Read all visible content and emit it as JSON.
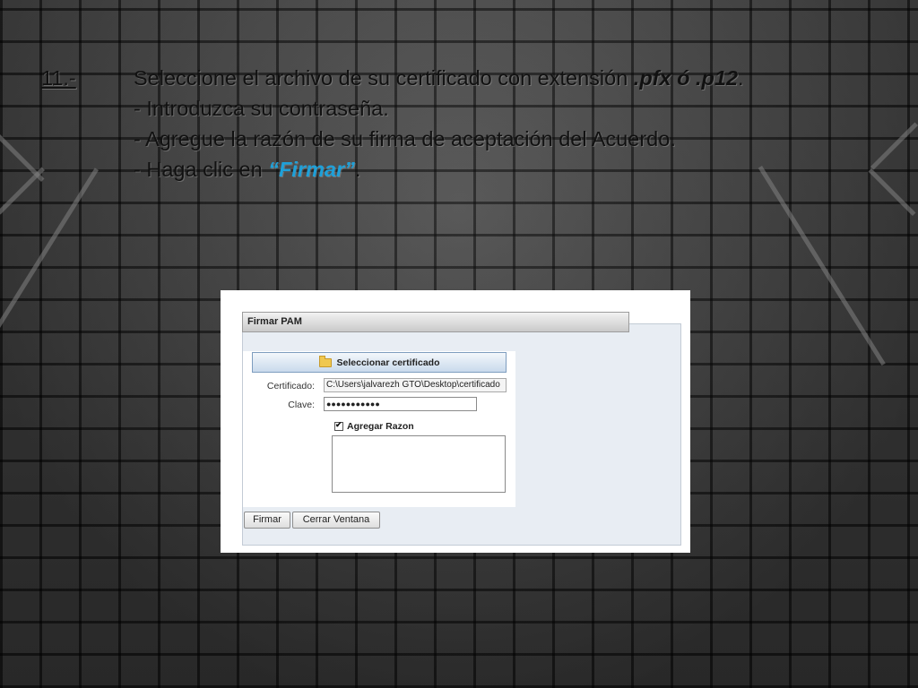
{
  "slide": {
    "step_number": "11.-",
    "line1_text": "Seleccione el archivo de su certificado con extensión ",
    "line1_emphasis": ".pfx ó .p12",
    "line1_end": ".",
    "line2": "- Introduzca su contraseña.",
    "line3": "- Agregue la razón de su firma de aceptación del Acuerdo.",
    "line4_prefix": "- Haga clic en ",
    "line4_emphasis": "“Firmar”",
    "line4_end": ".",
    "accent_color": "#1fa0d8"
  },
  "dialog": {
    "title": "Firmar PAM",
    "select_button_label": "Seleccionar certificado",
    "select_button_icon": "folder-icon",
    "cert_label": "Certificado:",
    "cert_value": "C:\\Users\\jalvarezh GTO\\Desktop\\certificado",
    "password_label": "Clave:",
    "password_value": "●●●●●●●●●●●",
    "add_reason_label": "Agregar Razon",
    "add_reason_checked": true,
    "sign_button_label": "Firmar",
    "close_button_label": "Cerrar Ventana"
  }
}
